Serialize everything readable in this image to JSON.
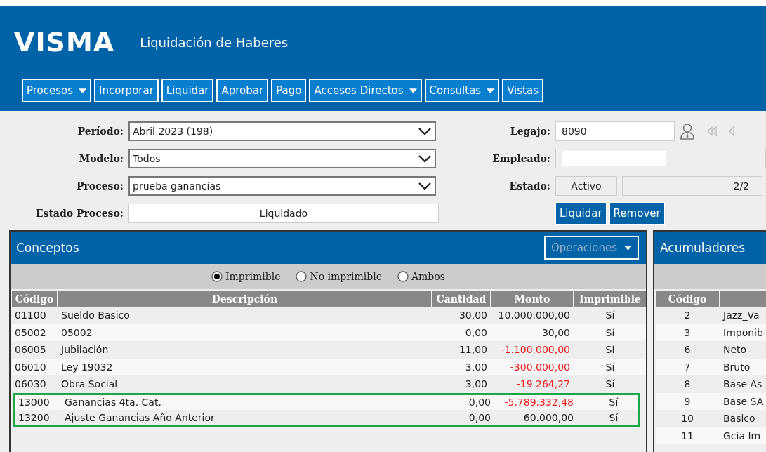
{
  "header": {
    "logo": "VISMA",
    "title": "Liquidación de Haberes"
  },
  "nav": [
    {
      "label": "Procesos",
      "dropdown": true
    },
    {
      "label": "Incorporar",
      "dropdown": false
    },
    {
      "label": "Liquidar",
      "dropdown": false
    },
    {
      "label": "Aprobar",
      "dropdown": false
    },
    {
      "label": "Pago",
      "dropdown": false
    },
    {
      "label": "Accesos Directos",
      "dropdown": true
    },
    {
      "label": "Consultas",
      "dropdown": true
    },
    {
      "label": "Vistas",
      "dropdown": false
    }
  ],
  "form_left": [
    {
      "label": "Período:",
      "value": "Abril 2023 (198)",
      "kind": "select"
    },
    {
      "label": "Modelo:",
      "value": "Todos",
      "kind": "select"
    },
    {
      "label": "Proceso:",
      "value": "prueba ganancias",
      "kind": "select"
    },
    {
      "label": "Estado Proceso:",
      "value": "Liquidado",
      "kind": "readonly"
    }
  ],
  "form_right": {
    "legajo_label": "Legajo:",
    "legajo": "8090",
    "empleado_label": "Empleado:",
    "estado_label": "Estado:",
    "estado": "Activo",
    "counter": "2/2",
    "buttons": [
      "Liquidar",
      "Remover"
    ]
  },
  "conceptos": {
    "title": "Conceptos",
    "operaciones": {
      "label": "Operaciones",
      "disabled": true
    },
    "filters": [
      {
        "label": "Imprimible",
        "selected": true
      },
      {
        "label": "No imprimible",
        "selected": false
      },
      {
        "label": "Ambos",
        "selected": false
      }
    ],
    "columns": [
      "Código",
      "Descripción",
      "Cantidad",
      "Monto",
      "Imprimible"
    ],
    "rows": [
      {
        "codigo": "01100",
        "descripcion": "Sueldo Basico",
        "cantidad": "30,00",
        "monto": "10.000.000,00",
        "negative": false,
        "imprimible": "Sí",
        "highlighted": false
      },
      {
        "codigo": "05002",
        "descripcion": "05002",
        "cantidad": "0,00",
        "monto": "30,00",
        "negative": false,
        "imprimible": "Sí",
        "highlighted": false
      },
      {
        "codigo": "06005",
        "descripcion": "Jubilación",
        "cantidad": "11,00",
        "monto": "-1.100.000,00",
        "negative": true,
        "imprimible": "Sí",
        "highlighted": false
      },
      {
        "codigo": "06010",
        "descripcion": "Ley 19032",
        "cantidad": "3,00",
        "monto": "-300.000,00",
        "negative": true,
        "imprimible": "Sí",
        "highlighted": false
      },
      {
        "codigo": "06030",
        "descripcion": "Obra Social",
        "cantidad": "3,00",
        "monto": "-19.264,27",
        "negative": true,
        "imprimible": "Sí",
        "highlighted": false
      },
      {
        "codigo": "13000",
        "descripcion": "Ganancias 4ta. Cat.",
        "cantidad": "0,00",
        "monto": "-5.789.332,48",
        "negative": true,
        "imprimible": "Sí",
        "highlighted": true
      },
      {
        "codigo": "13200",
        "descripcion": "Ajuste Ganancias Año Anterior",
        "cantidad": "0,00",
        "monto": "60.000,00",
        "negative": false,
        "imprimible": "Sí",
        "highlighted": true
      }
    ]
  },
  "acumuladores": {
    "title": "Acumuladores",
    "columns": [
      "Código"
    ],
    "rows": [
      {
        "codigo": "2",
        "column_2": "Jazz_Va"
      },
      {
        "codigo": "3",
        "column_2": "Imponib"
      },
      {
        "codigo": "6",
        "column_2": "Neto"
      },
      {
        "codigo": "7",
        "column_2": "Bruto"
      },
      {
        "codigo": "8",
        "column_2": "Base As"
      },
      {
        "codigo": "9",
        "column_2": "Base SA"
      },
      {
        "codigo": "10",
        "column_2": "Basico"
      },
      {
        "codigo": "11",
        "column_2": "Gcia Im"
      }
    ]
  }
}
